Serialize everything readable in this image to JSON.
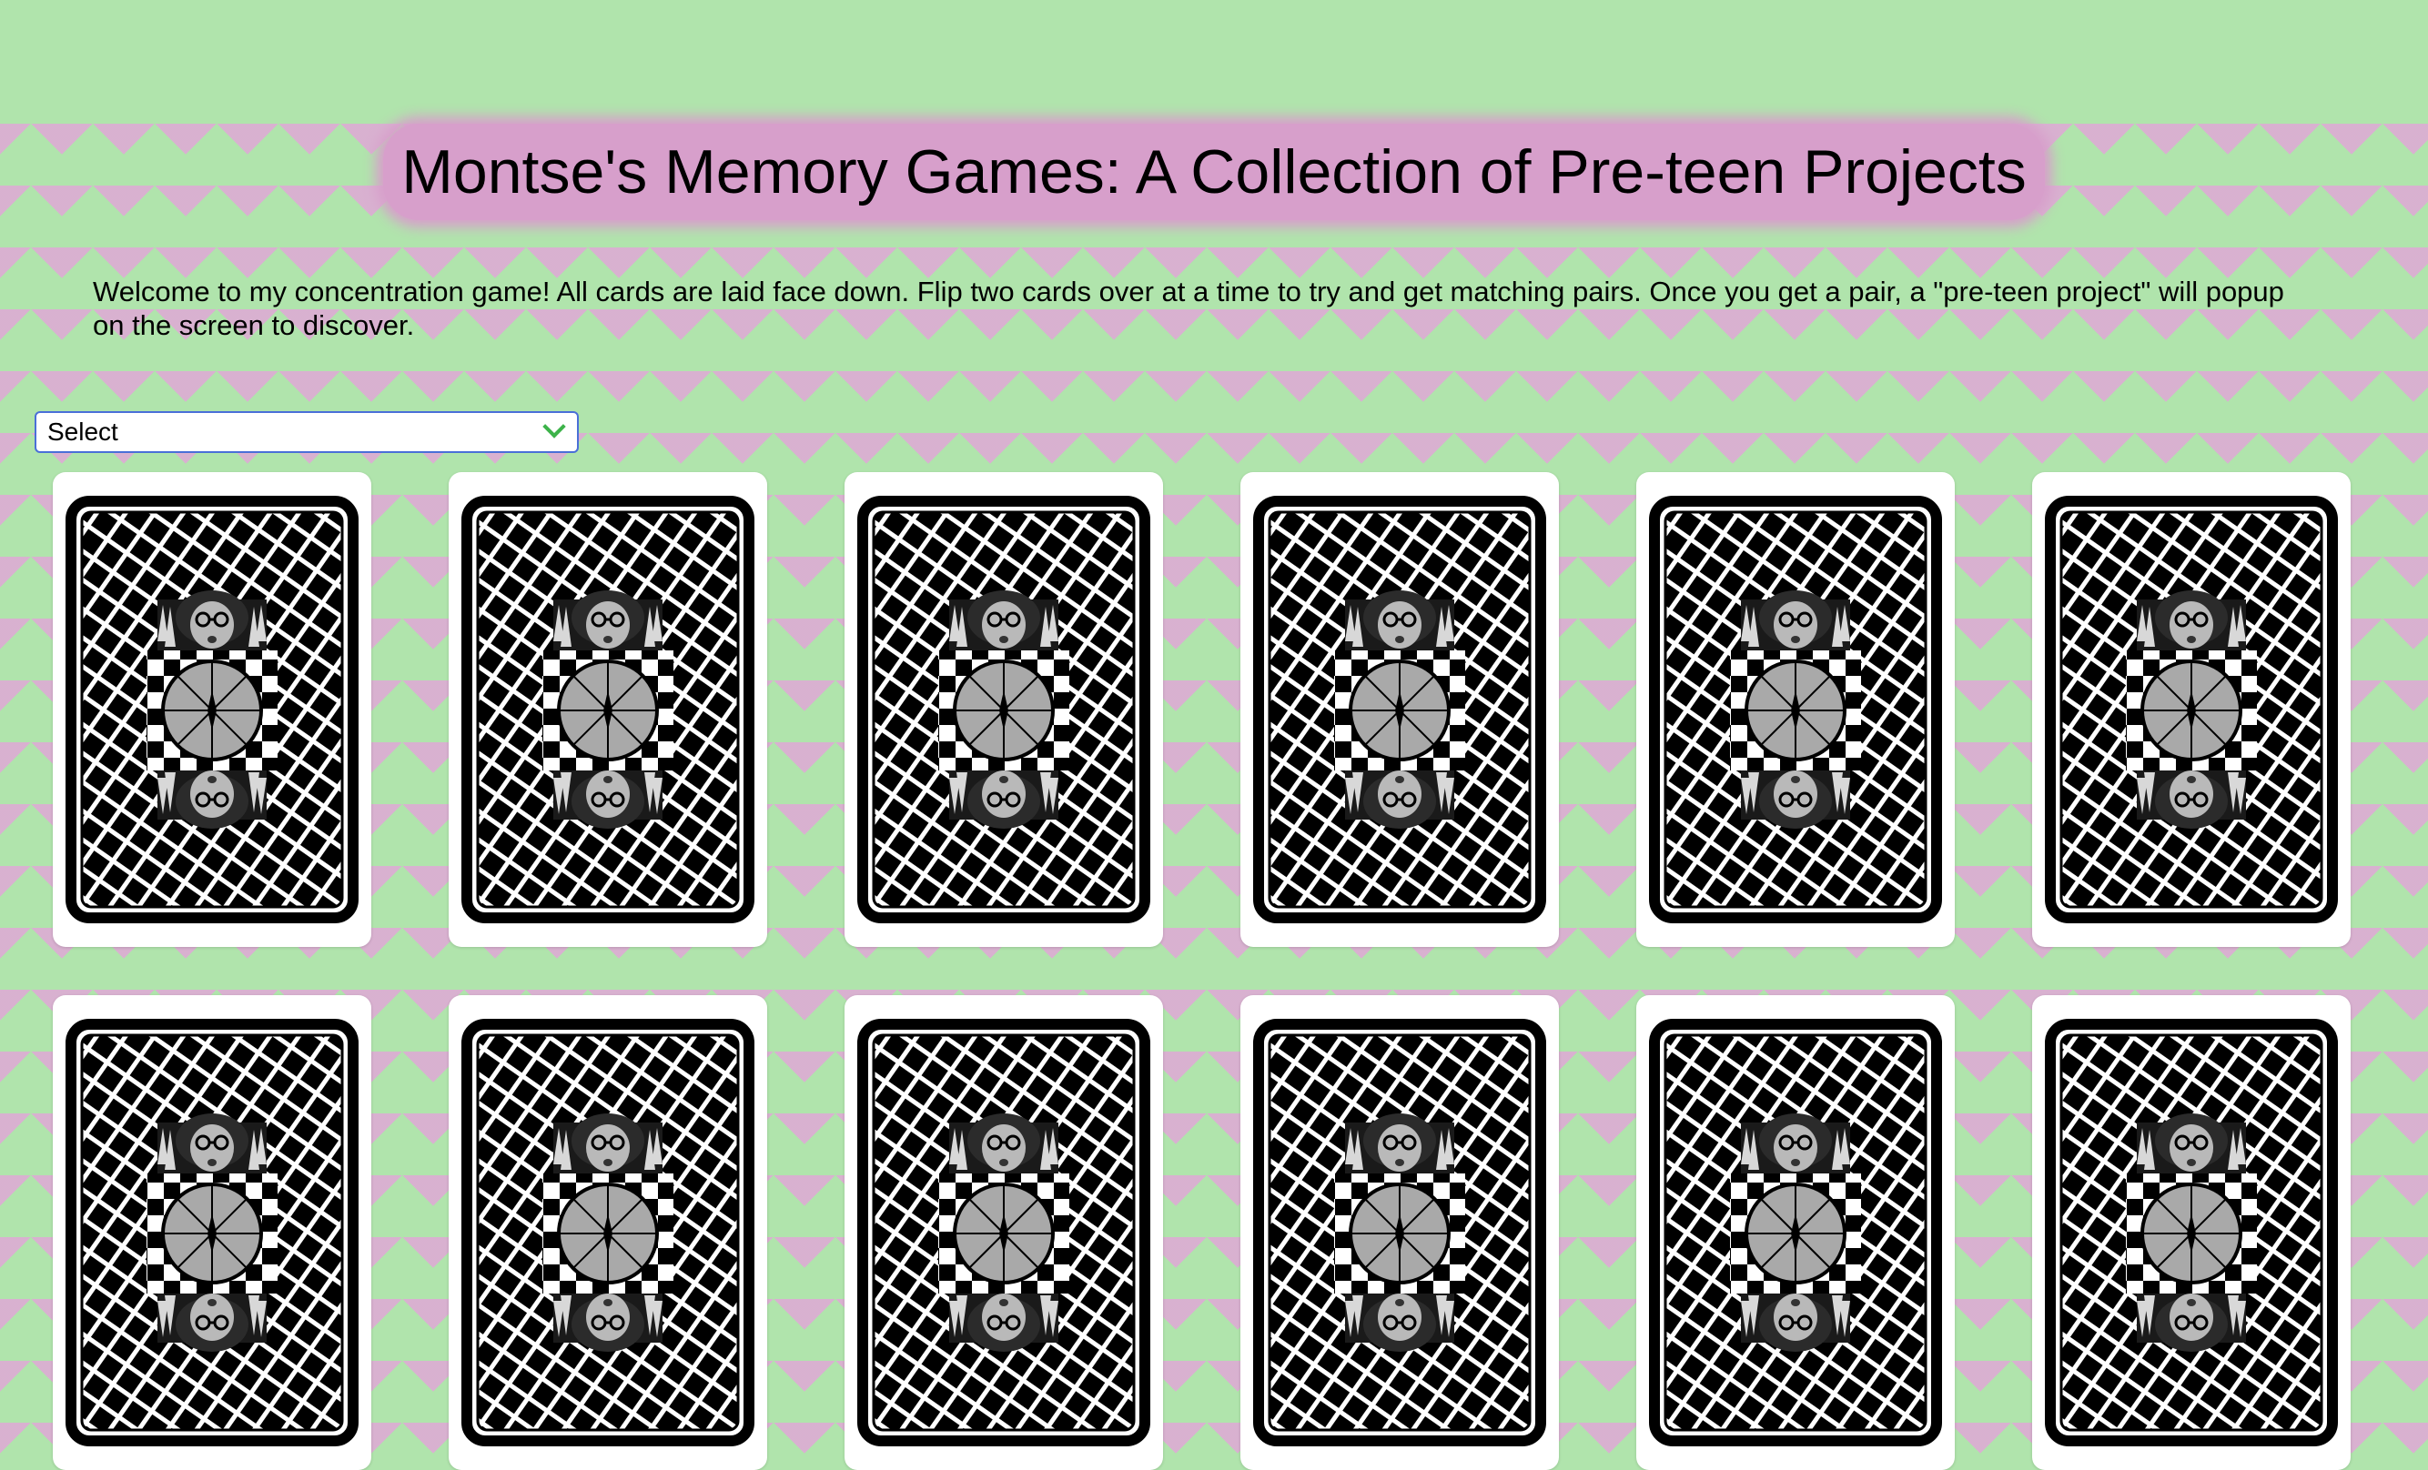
{
  "header": {
    "title": "Montse's Memory Games: A Collection of Pre-teen Projects"
  },
  "intro": {
    "text": "Welcome to my concentration game! All cards are laid face down. Flip two cards over at a time to try and get matching pairs. Once you get a pair, a \"pre-teen project\" will popup on the screen to discover."
  },
  "select": {
    "value": "Select"
  },
  "cards": {
    "count": 12,
    "state": "face-down"
  },
  "colors": {
    "background_green": "#b0e4ac",
    "background_pink": "#e0a8d6",
    "title_highlight": "#d79fcb",
    "select_border": "#4a6fd8",
    "select_chevron": "#3db34a"
  }
}
